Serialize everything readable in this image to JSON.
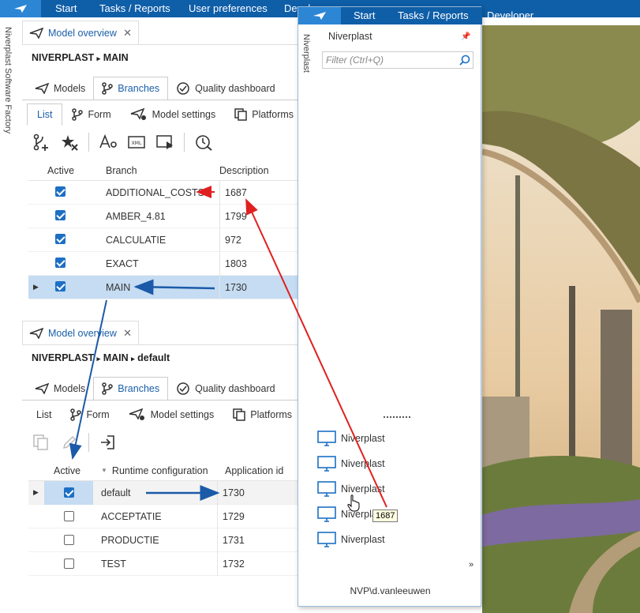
{
  "topnav": {
    "items": [
      "Start",
      "Tasks / Reports",
      "User preferences",
      "Developer"
    ]
  },
  "side_label": "Niverplast Software Factory",
  "top_section": {
    "doc_tab": "Model overview",
    "breadcrumb": {
      "a": "NIVERPLAST",
      "b": "MAIN"
    },
    "tabs": [
      "Models",
      "Branches",
      "Quality dashboard"
    ],
    "subtabs": [
      "List",
      "Form",
      "Model settings",
      "Platforms"
    ],
    "columns": [
      "Active",
      "Branch",
      "Description"
    ],
    "rows": [
      {
        "branch": "ADDITIONAL_COSTS",
        "desc": "1687",
        "active": true
      },
      {
        "branch": "AMBER_4.81",
        "desc": "1799",
        "active": true
      },
      {
        "branch": "CALCULATIE",
        "desc": "972",
        "active": true
      },
      {
        "branch": "EXACT",
        "desc": "1803",
        "active": true
      },
      {
        "branch": "MAIN",
        "desc": "1730",
        "active": true
      }
    ]
  },
  "bottom_section": {
    "doc_tab": "Model overview",
    "breadcrumb": {
      "a": "NIVERPLAST",
      "b": "MAIN",
      "c": "default"
    },
    "tabs": [
      "Models",
      "Branches",
      "Quality dashboard"
    ],
    "subtabs": [
      "List",
      "Form",
      "Model settings",
      "Platforms"
    ],
    "columns": [
      "Active",
      "Runtime configuration",
      "Application id"
    ],
    "rows": [
      {
        "config": "default",
        "appid": "1730",
        "active": true
      },
      {
        "config": "ACCEPTATIE",
        "appid": "1729",
        "active": false
      },
      {
        "config": "PRODUCTIE",
        "appid": "1731",
        "active": false
      },
      {
        "config": "TEST",
        "appid": "1732",
        "active": false
      }
    ]
  },
  "panel": {
    "nav": [
      "Start",
      "Tasks / Reports",
      "Developer"
    ],
    "side_label": "Niverplast",
    "title": "Niverplast",
    "filter_placeholder": "Filter (Ctrl+Q)",
    "apps": [
      "Niverplast",
      "Niverplast",
      "Niverplast",
      "Niverpla",
      "Niverplast"
    ],
    "user": "NVP\\d.vanleeuwen"
  },
  "tooltip": "1687",
  "colors": {
    "nav_bg": "#0f5ea8",
    "accent": "#2c86d4",
    "selection": "#c5dcf2",
    "arrow_red": "#e02020",
    "arrow_blue": "#1b5aa8"
  }
}
